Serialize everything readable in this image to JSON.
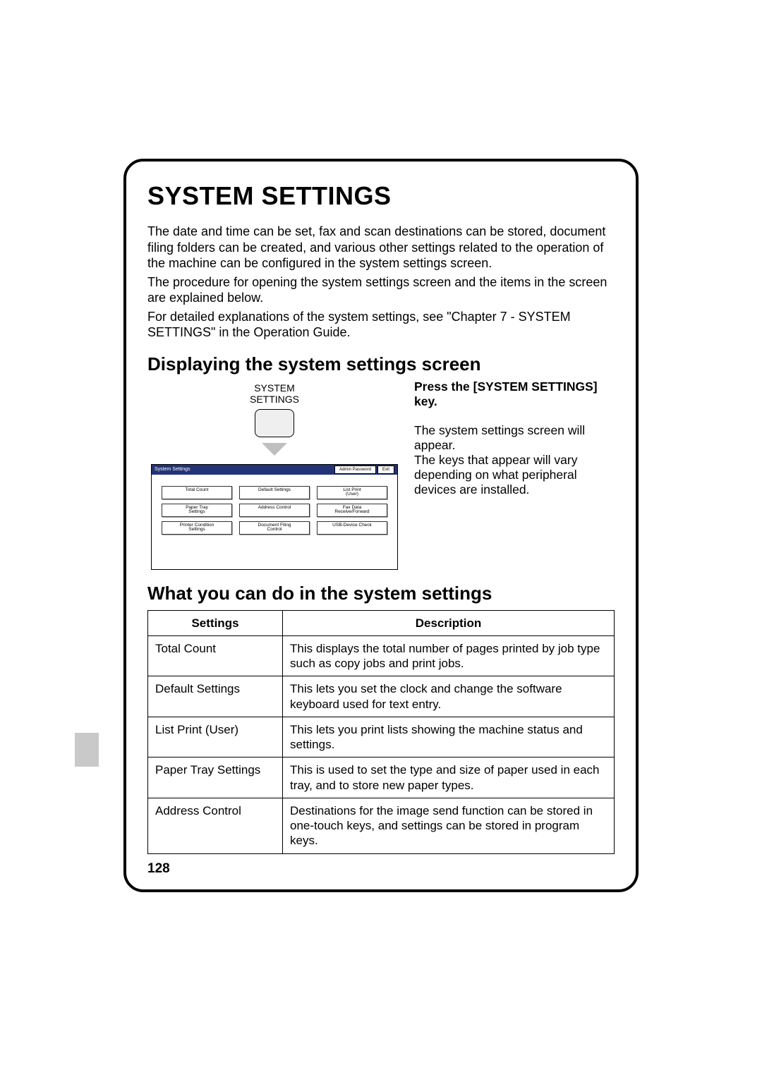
{
  "title": "SYSTEM SETTINGS",
  "intro_p1": "The date and time can be set, fax and scan destinations can be stored, document filing folders can be created, and various other settings related to the operation of the machine can be configured in the system settings screen.",
  "intro_p2": "The procedure for opening the system settings screen and the items in the screen are explained below.",
  "intro_p3": "For detailed explanations of the system settings, see \"Chapter 7 - SYSTEM SETTINGS\" in the Operation Guide.",
  "section1": "Displaying the system settings screen",
  "key_label_line1": "SYSTEM",
  "key_label_line2": "SETTINGS",
  "screen_header_title": "System Settings",
  "screen_header_admin": "Admin Password",
  "screen_header_exit": "Exit",
  "screen_buttons": [
    "Total Count",
    "Default Settings",
    "List Print\n(User)",
    "Paper Tray\nSettings",
    "Address Control",
    "Fax Data\nReceive/Forward",
    "Printer Condition\nSettings",
    "Document Filing\nControl",
    "USB-Device Check"
  ],
  "right_bold": "Press the [SYSTEM SETTINGS] key.",
  "right_p1": "The system settings screen will appear.",
  "right_p2": "The keys that appear will vary depending on what peripheral devices are installed.",
  "section2": "What you can do in the system settings",
  "table": {
    "head_settings": "Settings",
    "head_description": "Description",
    "rows": [
      {
        "s": "Total Count",
        "d": "This displays the total number of pages printed by job type such as copy jobs and print jobs."
      },
      {
        "s": "Default Settings",
        "d": "This lets you set the clock and change the software keyboard used for text entry."
      },
      {
        "s": "List Print (User)",
        "d": "This lets you print lists showing the machine status and settings."
      },
      {
        "s": "Paper Tray Settings",
        "d": "This is used to set the type and size of paper used in each tray, and to store new paper types."
      },
      {
        "s": "Address Control",
        "d": "Destinations for the image send function can be stored in one-touch keys, and settings can be stored in program keys."
      }
    ]
  },
  "page_number": "128"
}
